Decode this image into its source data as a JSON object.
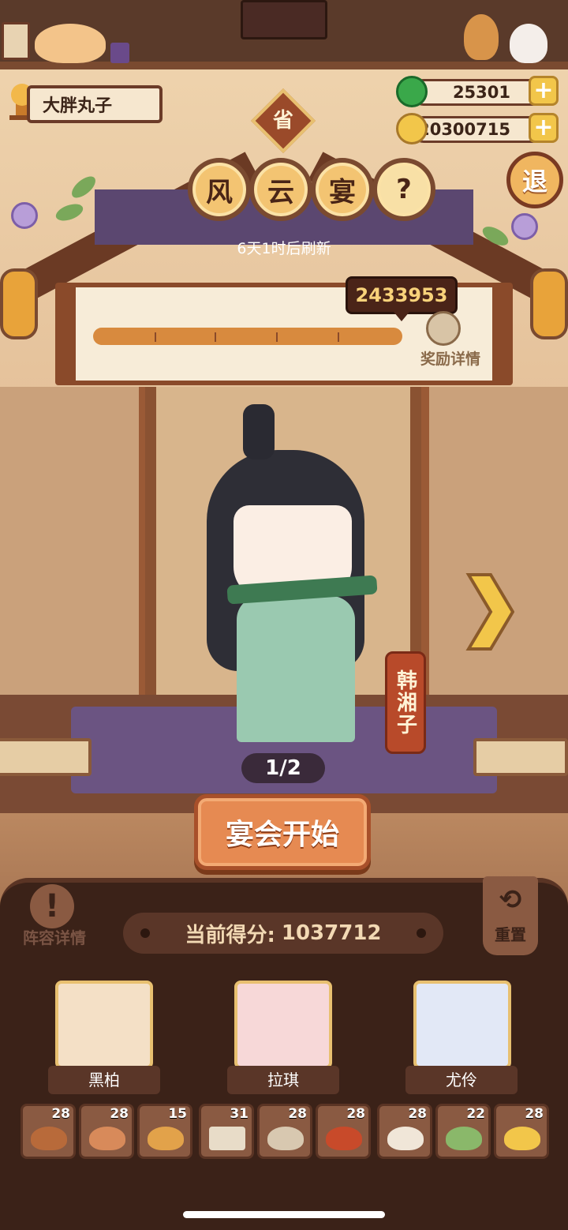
{
  "player": {
    "name": "大胖丸子"
  },
  "currency": {
    "jade": {
      "value": "25301",
      "icon": "jade-coin-icon",
      "add": "+"
    },
    "gold": {
      "value": "20300715",
      "icon": "gold-coin-icon",
      "add": "+"
    }
  },
  "province_badge": "省",
  "title_chars": [
    "风",
    "云",
    "宴",
    "?"
  ],
  "retreat_label": "退",
  "refresh_text": "6天1时后刷新",
  "target_score": "2433953",
  "reward_detail_label": "奖励详情",
  "character": {
    "name": "韩湘子",
    "page": "1/2"
  },
  "start_button": "宴会开始",
  "lineup_detail": {
    "icon": "!",
    "label": "阵容详情"
  },
  "current_score": {
    "label": "当前得分:",
    "value": "1037712"
  },
  "reset": {
    "icon": "⟲",
    "label": "重置"
  },
  "heroes": [
    {
      "name": "黑柏",
      "bg": "#f4e0c6"
    },
    {
      "name": "拉琪",
      "bg": "#f7d8d8"
    },
    {
      "name": "尤伶",
      "bg": "#e2e8f6"
    }
  ],
  "dishes": [
    {
      "count": "28",
      "color": "#b86a3a"
    },
    {
      "count": "28",
      "color": "#d88a5a"
    },
    {
      "count": "15",
      "color": "#e2a24a"
    },
    {
      "count": "31",
      "color": "#e8dcc8"
    },
    {
      "count": "28",
      "color": "#d8c8b0"
    },
    {
      "count": "28",
      "color": "#c84a2a"
    },
    {
      "count": "28",
      "color": "#f0e6d8"
    },
    {
      "count": "22",
      "color": "#8ab86a"
    },
    {
      "count": "28",
      "color": "#f2c64a"
    }
  ],
  "colors": {
    "accent": "#f2c64a",
    "panel": "#3b2218",
    "button": "#e68a52"
  }
}
